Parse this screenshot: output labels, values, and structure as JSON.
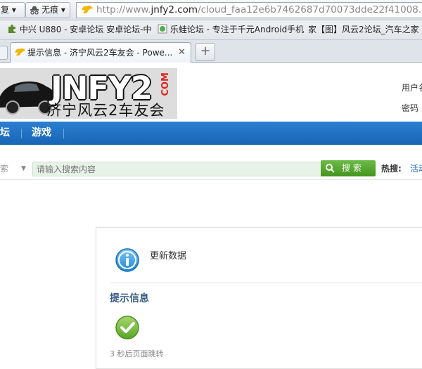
{
  "browser": {
    "nav_buttons": [
      {
        "label": "复 ▾",
        "icon": "restore-icon"
      },
      {
        "label": "无痕 ▾",
        "icon": "incognito-icon"
      }
    ],
    "url_base": "http://www.",
    "url_domain": "jnfy2.com",
    "url_path": "/cloud_faa12e6b7462687d70073dde22f41008.php",
    "bookmarks": [
      {
        "label": "中兴 U880 - 安卓论坛 安卓论坛-中",
        "icon": "puzzle-icon"
      },
      {
        "label": "乐蛙论坛 - 专注于千元Android手机",
        "icon": "frog-icon"
      },
      {
        "label": "家【图】风云2论坛_汽车之家",
        "icon": "home-icon"
      }
    ],
    "tab_title": "提示信息 - 济宁风云2车友会 - Powe...",
    "tab_close": "✕",
    "new_tab": "+"
  },
  "site": {
    "logo_text": "JNFY2",
    "logo_com": "COM",
    "logo_sub": "济宁风云2车友会",
    "login_username_label": "用户名",
    "login_password_label": "密码",
    "nav": [
      {
        "label": "坛"
      },
      {
        "label": "游戏"
      }
    ],
    "search": {
      "type_label": "索",
      "placeholder": "请输入搜索内容",
      "button_label": "搜 索",
      "hot_label": "热搜:",
      "hot_item": "活动"
    }
  },
  "message": {
    "update_text": "更新数据",
    "title": "提示信息",
    "redirect_text": "3 秒后页面跳转"
  },
  "colors": {
    "nav_blue": "#1865b5",
    "search_green": "#4ea22a",
    "title_blue": "#3b5d84",
    "success_green": "#7dc241"
  }
}
